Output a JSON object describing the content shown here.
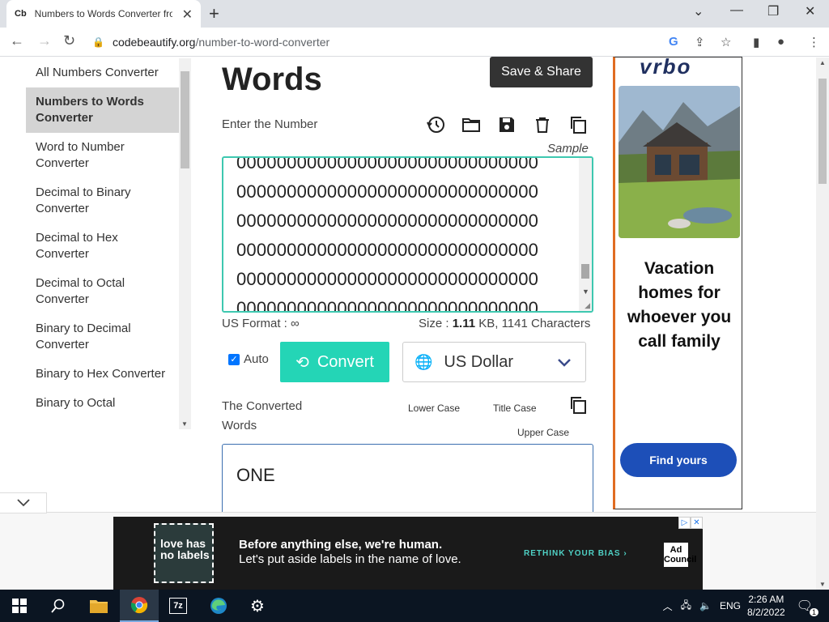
{
  "browser": {
    "tab_favicon": "Cb",
    "tab_title": "Numbers to Words Converter fro",
    "url_host": "codebeautify.org",
    "url_path": "/number-to-word-converter"
  },
  "sidebar": {
    "items": [
      {
        "label": "All Numbers Converter",
        "active": false
      },
      {
        "label": "Numbers to Words Converter",
        "active": true
      },
      {
        "label": "Word to Number Converter",
        "active": false
      },
      {
        "label": "Decimal to Binary Converter",
        "active": false
      },
      {
        "label": "Decimal to Hex Converter",
        "active": false
      },
      {
        "label": "Decimal to Octal Converter",
        "active": false
      },
      {
        "label": "Binary to Decimal Converter",
        "active": false
      },
      {
        "label": "Binary to Hex Converter",
        "active": false
      },
      {
        "label": "Binary to Octal",
        "active": false
      }
    ]
  },
  "main": {
    "heading": "Words",
    "save_share": "Save & Share",
    "enter_label": "Enter the Number",
    "sample": "Sample",
    "number_lines": [
      "000000000000000000000000000000",
      "000000000000000000000000000000",
      "000000000000000000000000000000",
      "000000000000000000000000000000",
      "000000000000000000000000000000",
      "000000000000000000000000000000"
    ],
    "us_format": "US Format : ∞",
    "size_prefix": "Size : ",
    "size_value": "1.11",
    "size_suffix": " KB, 1141 Characters",
    "auto_label": "Auto",
    "auto_checked": true,
    "convert_label": "Convert",
    "currency": "US Dollar",
    "converted_label": "The Converted Words",
    "lower_case": "Lower Case",
    "title_case": "Title Case",
    "upper_case": "Upper Case",
    "output_text": "ONE"
  },
  "ad_right": {
    "headline": "Vacation homes for whoever you call family",
    "cta": "Find yours"
  },
  "ad_bottom": {
    "badge": "love has no labels",
    "line1": "Before anything else, we're human.",
    "line2": "Let's put aside labels in the name of love.",
    "rethink": "RETHINK YOUR BIAS ›",
    "adcouncil": "Ad Council"
  },
  "taskbar": {
    "lang": "ENG",
    "time": "2:26 AM",
    "date": "8/2/2022",
    "notif_count": "1"
  },
  "colors": {
    "accent_teal": "#24d5b6",
    "input_border": "#3ec8b0",
    "save_button": "#333333",
    "cta_blue": "#1d4fb8"
  }
}
